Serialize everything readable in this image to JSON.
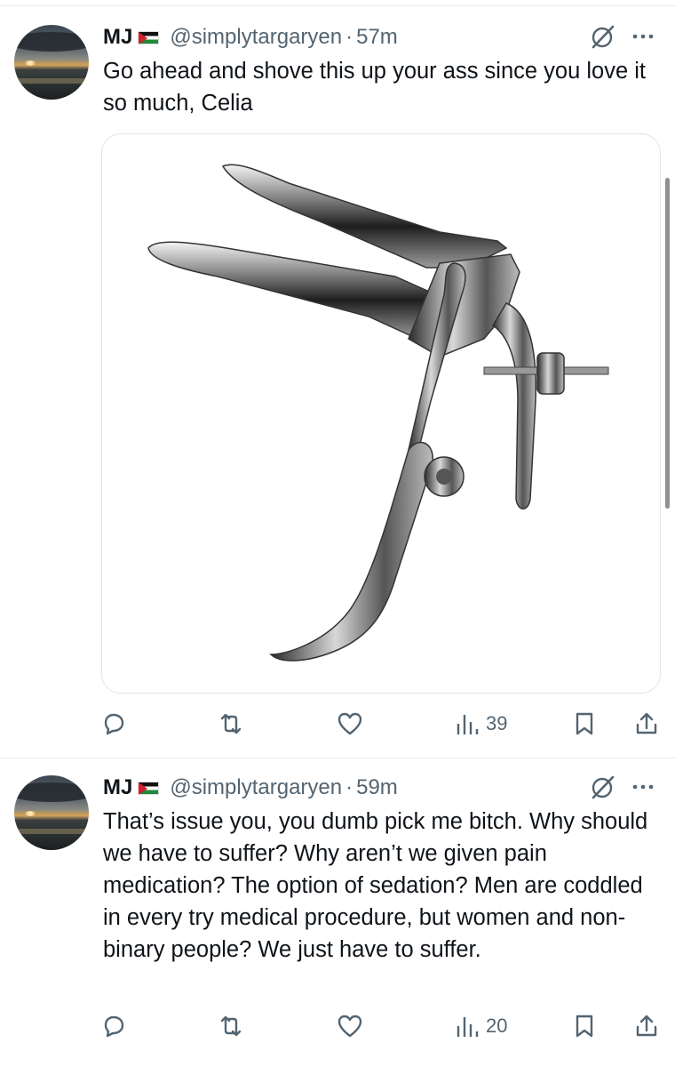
{
  "tweets": [
    {
      "display_name": "MJ",
      "handle": "@simplytargaryen",
      "separator": "·",
      "time": "57m",
      "text": "Go ahead and shove this up your ass since you love it so much, Celia",
      "media_subject": "speculum-image",
      "views": "39"
    },
    {
      "display_name": "MJ",
      "handle": "@simplytargaryen",
      "separator": "·",
      "time": "59m",
      "text": "That’s issue you, you dumb pick me bitch. Why should we have to suffer? Why aren’t we given pain medication? The option of sedation? Men are coddled in every try medical procedure, but women and non-binary people? We just have to suffer.",
      "views": "20"
    }
  ],
  "icons": {
    "flag": "palestine-flag-icon",
    "grok": "grok-icon",
    "more": "more-icon",
    "reply": "reply-icon",
    "repost": "repost-icon",
    "like": "like-icon",
    "views": "views-icon",
    "bookmark": "bookmark-icon",
    "share": "share-icon"
  },
  "colors": {
    "text": "#0f1419",
    "secondary": "#536471",
    "divider": "#e6e9ec"
  }
}
